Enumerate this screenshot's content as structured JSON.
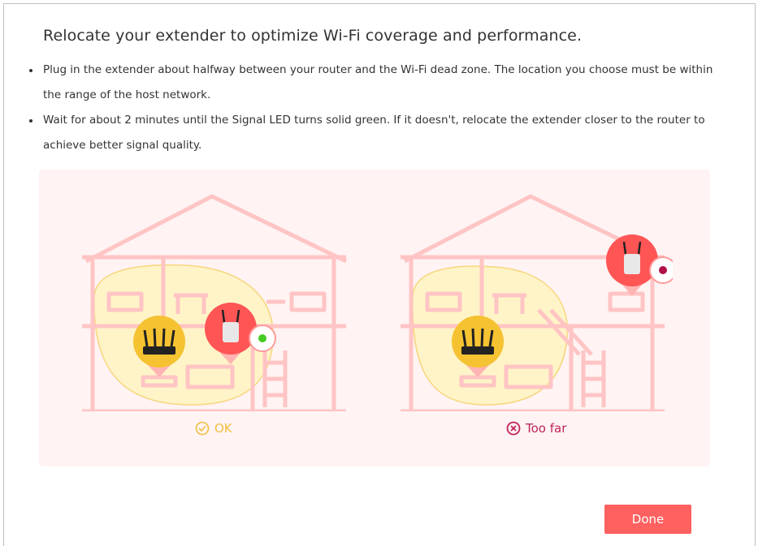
{
  "title": "Relocate your extender to optimize Wi-Fi coverage and performance.",
  "instructions": [
    "Plug in the extender about halfway between your router and the Wi-Fi dead zone. The location you choose must be within the range of the host network.",
    "Wait for about 2 minutes until the Signal LED turns solid green. If it doesn't, relocate the extender closer to the router to achieve better signal quality."
  ],
  "illustrations": {
    "ok": {
      "caption": "OK",
      "caption_color": "#f0c040",
      "led_color": "#44cc22"
    },
    "too_far": {
      "caption": "Too far",
      "caption_color": "#c0245c",
      "led_color": "#b0104a"
    }
  },
  "done_button": {
    "label": "Done",
    "color": "#ff6060"
  },
  "colors": {
    "house_line": "#ffc4c4",
    "panel_bg": "#fff3f3",
    "coverage_fill": "#fff4c8",
    "coverage_stroke": "#f7d67e",
    "router_badge": "#f5c232",
    "extender_badge": "#ff5555"
  }
}
